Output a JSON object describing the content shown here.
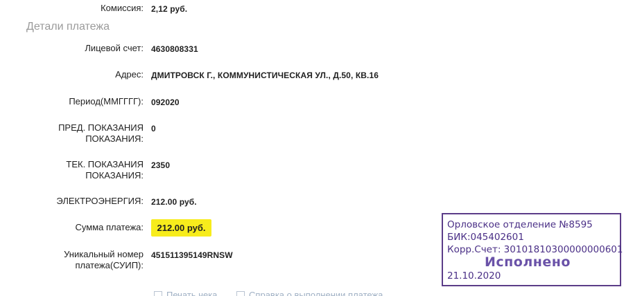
{
  "commission": {
    "label": "Комиссия:",
    "value": "2,12 руб."
  },
  "section_title": "Детали платежа",
  "details": {
    "account": {
      "label": "Лицевой счет:",
      "value": "4630808331"
    },
    "address": {
      "label": "Адрес:",
      "value": "ДМИТРОВСК Г., КОММУНИСТИЧЕСКАЯ УЛ., Д.50, КВ.16"
    },
    "period": {
      "label": "Период(ММГГГГ):",
      "value": "092020"
    },
    "prev_reading": {
      "label_line1": "ПРЕД. ПОКАЗАНИЯ",
      "label_line2": "ПОКАЗАНИЯ:",
      "value": "0"
    },
    "curr_reading": {
      "label_line1": "ТЕК. ПОКАЗАНИЯ",
      "label_line2": "ПОКАЗАНИЯ:",
      "value": "2350"
    },
    "electricity": {
      "label": "ЭЛЕКТРОЭНЕРГИЯ:",
      "value": "212.00 руб."
    },
    "payment_sum": {
      "label": "Сумма платежа:",
      "value": "212.00 руб."
    },
    "uin": {
      "label_line1": "Уникальный номер",
      "label_line2": "платежа(СУИП):",
      "value": "451511395149RNSW"
    }
  },
  "stamp": {
    "branch": "Орловское отделение №8595",
    "bik": "БИК:045402601",
    "corr": "Корр.Счет: 30101810300000000601",
    "status": "Исполнено",
    "date": "21.10.2020",
    "color": "#5b3c88"
  },
  "links": {
    "print_receipt": "Печать чека",
    "certificate": "Справка о выполнении платежа"
  },
  "colors": {
    "highlight": "#f7ec1c",
    "section_title": "#9a9a9a"
  }
}
